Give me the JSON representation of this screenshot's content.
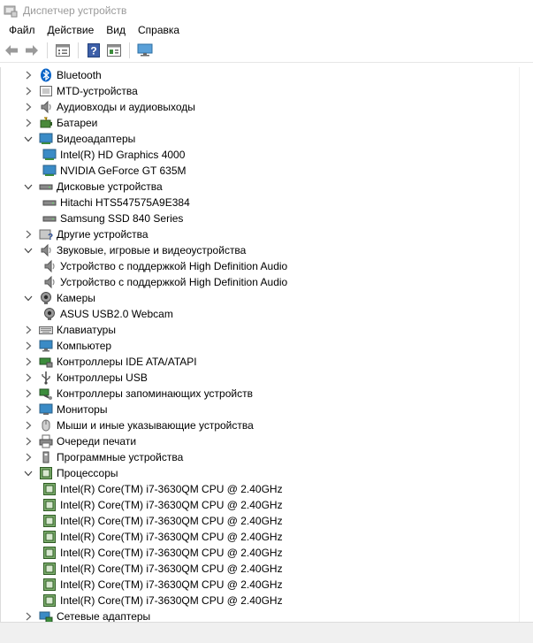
{
  "window": {
    "title": "Диспетчер устройств"
  },
  "menu": {
    "file": "Файл",
    "action": "Действие",
    "view": "Вид",
    "help": "Справка"
  },
  "tree": {
    "bluetooth": "Bluetooth",
    "mtd": "MTD-устройства",
    "audio_io": "Аудиовходы и аудиовыходы",
    "batteries": "Батареи",
    "video": "Видеоадаптеры",
    "video_1": "Intel(R) HD Graphics 4000",
    "video_2": "NVIDIA GeForce GT 635M",
    "disks": "Дисковые устройства",
    "disk_1": "Hitachi HTS547575A9E384",
    "disk_2": "Samsung SSD 840 Series",
    "other": "Другие устройства",
    "sound": "Звуковые, игровые и видеоустройства",
    "sound_1": "Устройство с поддержкой High Definition Audio",
    "sound_2": "Устройство с поддержкой High Definition Audio",
    "cameras": "Камеры",
    "camera_1": "ASUS USB2.0 Webcam",
    "keyboards": "Клавиатуры",
    "computer": "Компьютер",
    "ide": "Контроллеры IDE ATA/ATAPI",
    "usb": "Контроллеры USB",
    "storage": "Контроллеры запоминающих устройств",
    "monitors": "Мониторы",
    "mice": "Мыши и иные указывающие устройства",
    "print_queues": "Очереди печати",
    "software": "Программные устройства",
    "processors": "Процессоры",
    "cpus": [
      "Intel(R) Core(TM) i7-3630QM CPU @ 2.40GHz",
      "Intel(R) Core(TM) i7-3630QM CPU @ 2.40GHz",
      "Intel(R) Core(TM) i7-3630QM CPU @ 2.40GHz",
      "Intel(R) Core(TM) i7-3630QM CPU @ 2.40GHz",
      "Intel(R) Core(TM) i7-3630QM CPU @ 2.40GHz",
      "Intel(R) Core(TM) i7-3630QM CPU @ 2.40GHz",
      "Intel(R) Core(TM) i7-3630QM CPU @ 2.40GHz",
      "Intel(R) Core(TM) i7-3630QM CPU @ 2.40GHz"
    ],
    "network": "Сетевые адаптеры"
  }
}
